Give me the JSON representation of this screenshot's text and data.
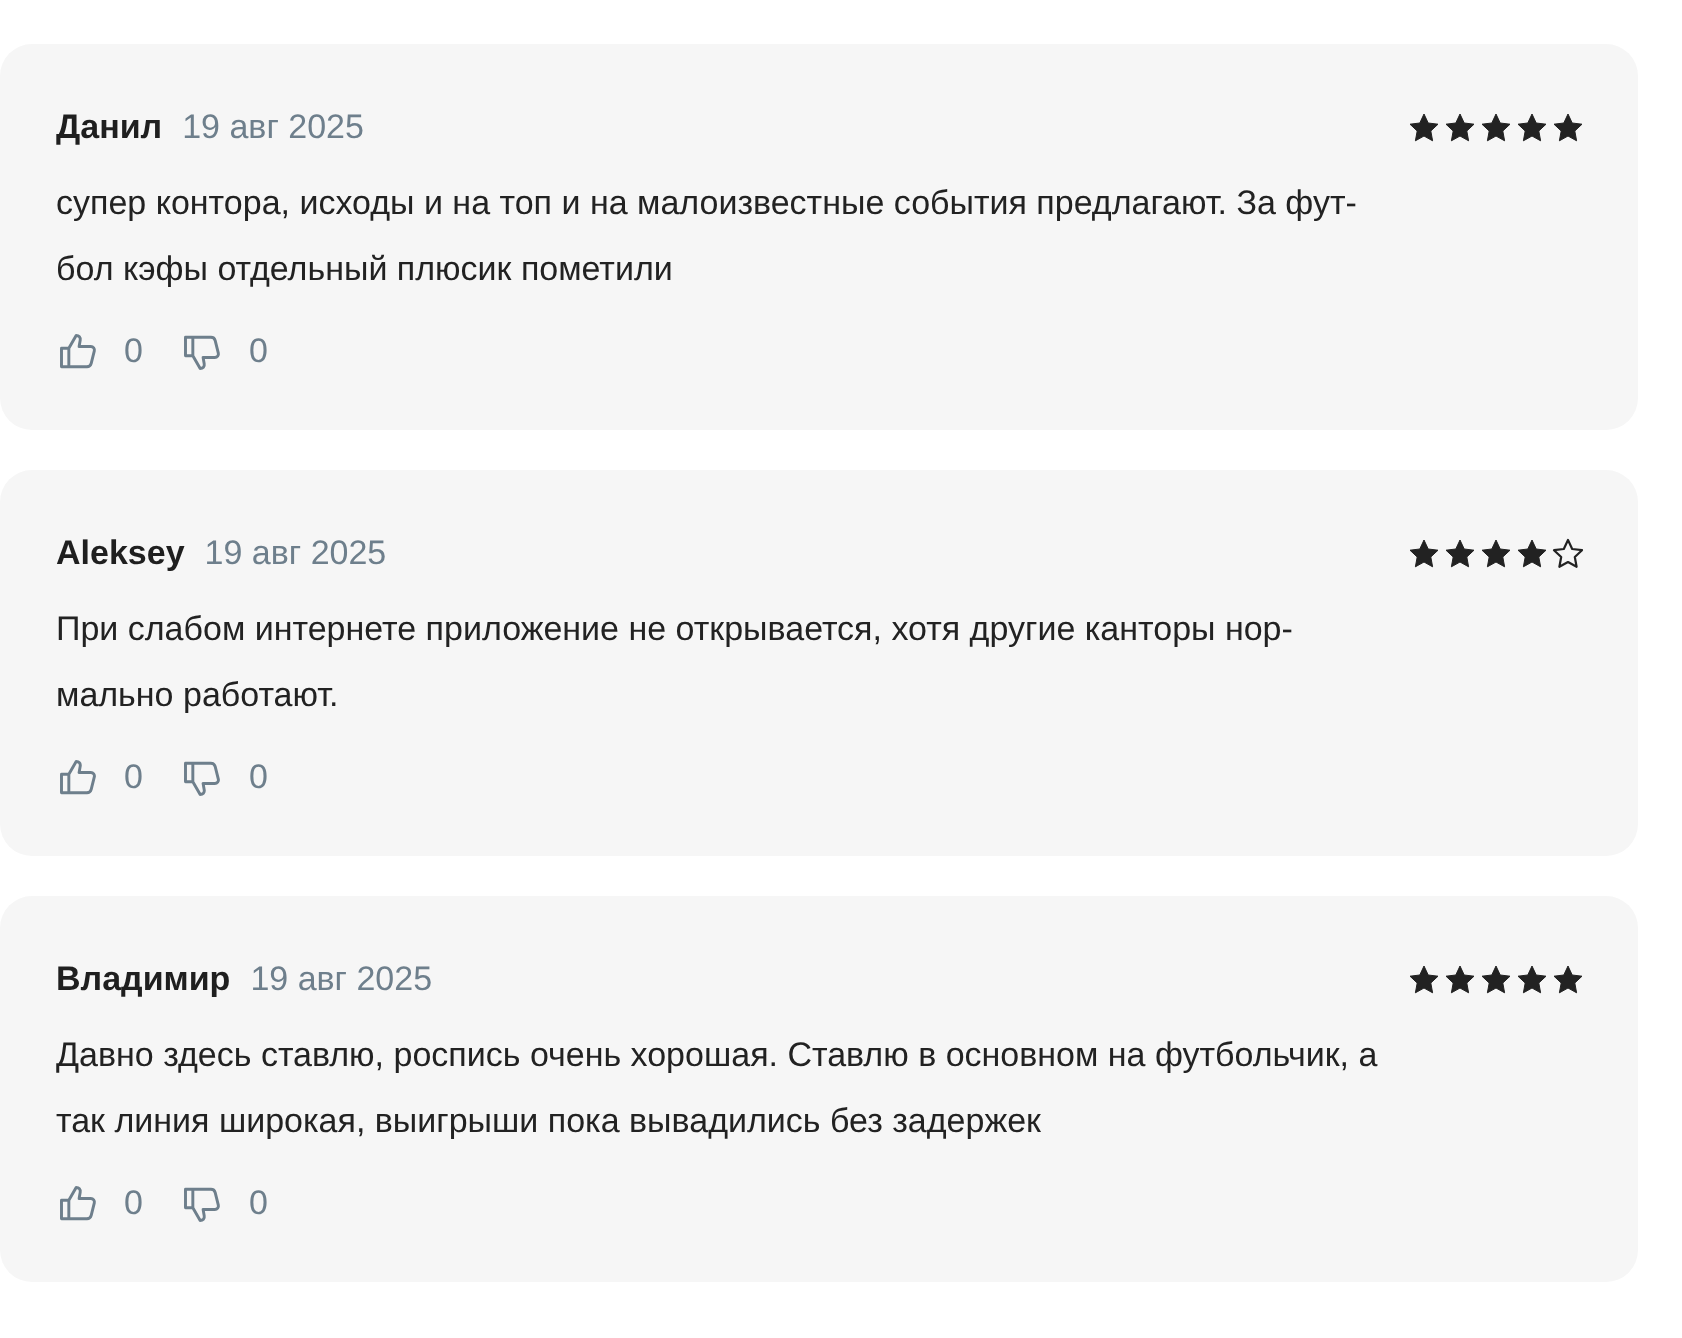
{
  "reviews": [
    {
      "author": "Данил",
      "date": "19 авг 2025",
      "stars": 5,
      "text_lines": [
        "супер контора, исходы и на топ и на малоизвестные события предлагают. За фут-",
        "бол кэфы отдельный плюсик пометили"
      ],
      "likes": "0",
      "dislikes": "0"
    },
    {
      "author": "Aleksey",
      "date": "19 авг 2025",
      "stars": 4,
      "text_lines": [
        "При слабом интернете приложение не открывается, хотя другие канторы нор-",
        "мально работают."
      ],
      "likes": "0",
      "dislikes": "0"
    },
    {
      "author": "Владимир",
      "date": "19 авг 2025",
      "stars": 5,
      "text_lines": [
        "Давно здесь ставлю, роспись очень хорошая. Ставлю в основном на футбольчик, а",
        "так линия широкая, выигрыши пока вывадились без задержек"
      ],
      "likes": "0",
      "dislikes": "0"
    }
  ]
}
